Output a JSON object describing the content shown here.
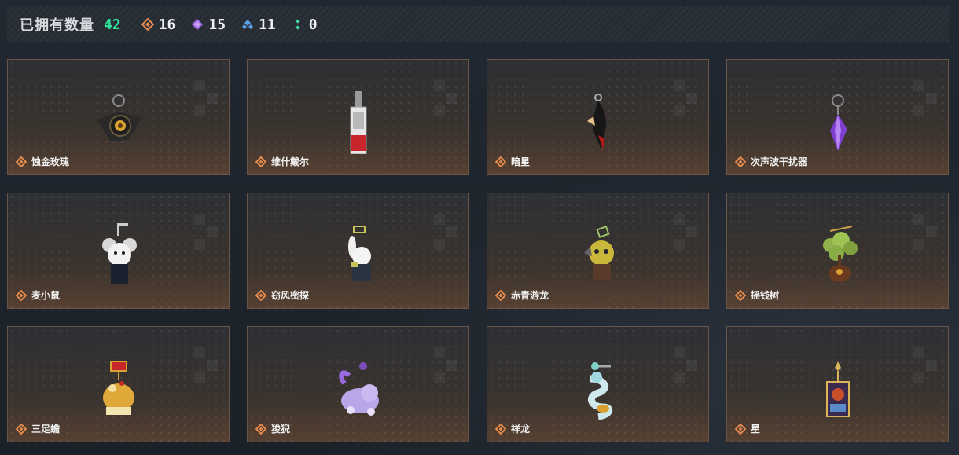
{
  "header": {
    "owned_label": "已拥有数量",
    "owned_count": "42",
    "rarities": [
      {
        "icon": "orange-diamond-icon",
        "color": "#e38a4c",
        "count": "16"
      },
      {
        "icon": "purple-diamond-icon",
        "color": "#a56be6",
        "count": "15"
      },
      {
        "icon": "blue-diamond-icon",
        "color": "#5aa0e6",
        "count": "11"
      },
      {
        "icon": "green-dots-icon",
        "color": "#3fd89a",
        "count": "0"
      }
    ]
  },
  "items": [
    {
      "name": "蚀金玫瑰",
      "icon": "gold-rose-charm-icon"
    },
    {
      "name": "维什戴尔",
      "icon": "tag-charm-icon"
    },
    {
      "name": "暗星",
      "icon": "dark-star-charm-icon"
    },
    {
      "name": "次声波干扰器",
      "icon": "purple-crystal-charm-icon"
    },
    {
      "name": "麦小鼠",
      "icon": "mouse-charm-icon"
    },
    {
      "name": "窃风密探",
      "icon": "rabbit-spy-charm-icon"
    },
    {
      "name": "赤青游龙",
      "icon": "dragon-mascot-charm-icon"
    },
    {
      "name": "摇钱树",
      "icon": "money-tree-charm-icon"
    },
    {
      "name": "三足蟾",
      "icon": "golden-toad-charm-icon"
    },
    {
      "name": "狻猊",
      "icon": "purple-lion-charm-icon"
    },
    {
      "name": "祥龙",
      "icon": "auspicious-dragon-charm-icon"
    },
    {
      "name": "星",
      "icon": "star-card-charm-icon"
    }
  ],
  "colors": {
    "accent_green": "#2fe39a",
    "rarity_orange": "#e38a4c",
    "card_border": "#6a5647"
  }
}
